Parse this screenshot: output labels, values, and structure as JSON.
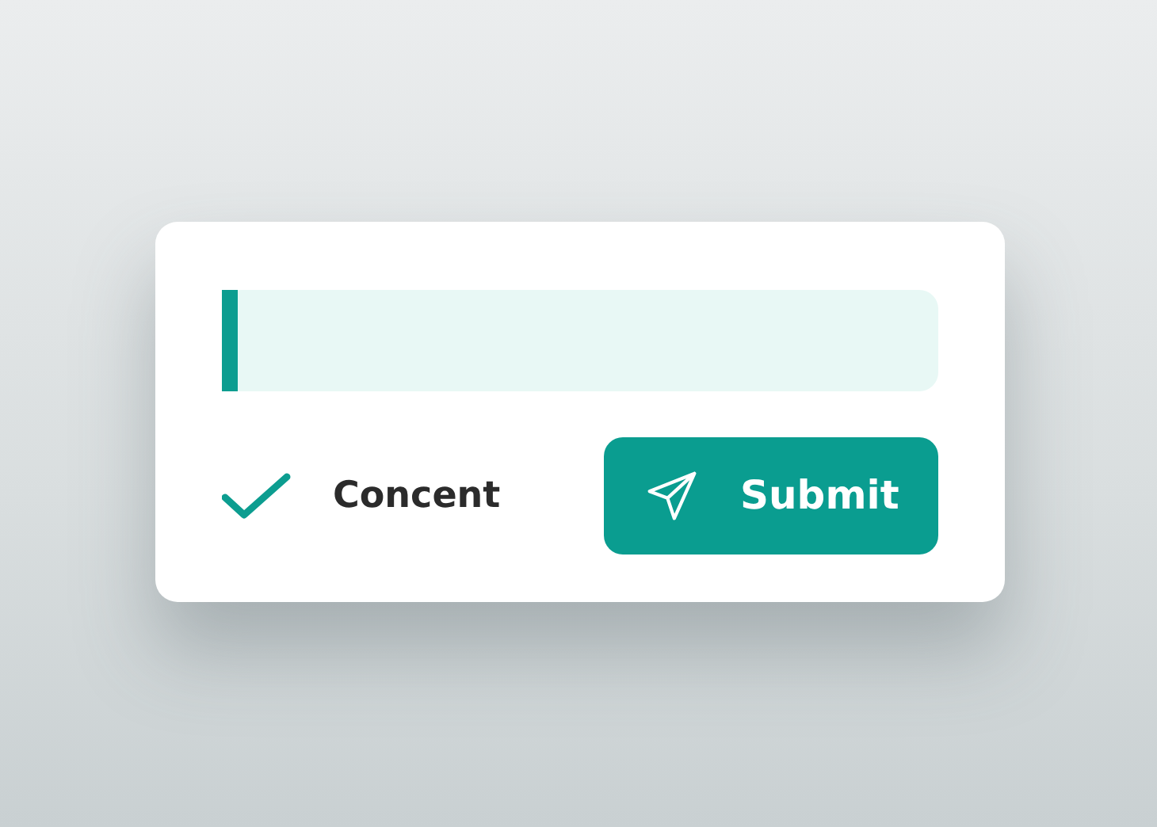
{
  "field": {
    "focused": true
  },
  "consent": {
    "label": "Concent",
    "checked": true
  },
  "submit": {
    "label": "Submit"
  }
}
